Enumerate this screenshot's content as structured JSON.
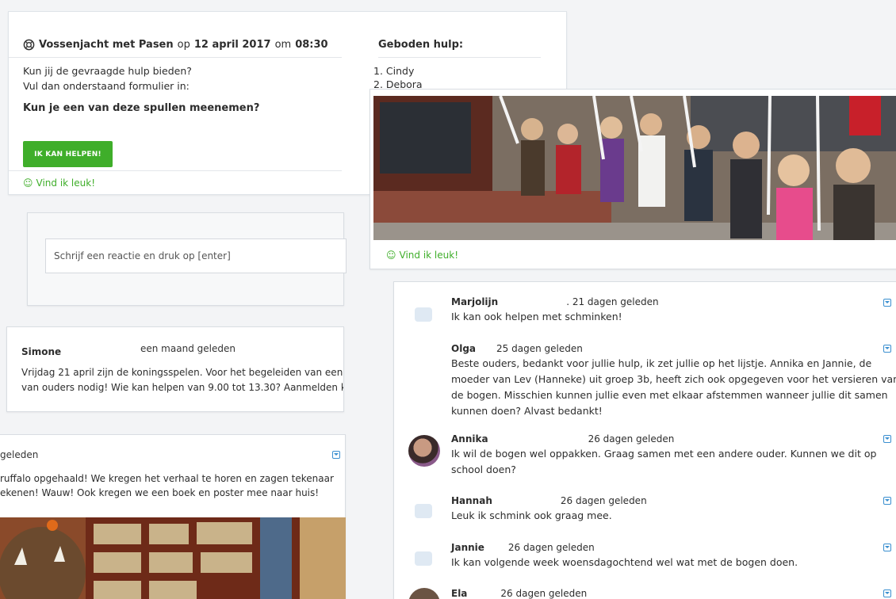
{
  "event": {
    "title": "Vossenjacht met Pasen",
    "date_prefix": "op",
    "date": "12 april 2017",
    "time_prefix": "om",
    "time": "08:30",
    "question_1": "Kun jij de gevraagde hulp bieden?",
    "question_2": "Vul dan onderstaand formulier in:",
    "items_question": "Kun je een van deze spullen meenemen?",
    "help_button": "IK KAN HELPEN!",
    "like_label": "Vind ik leuk!",
    "offered_title": "Geboden hulp:",
    "offered": [
      "1. Cindy",
      "2. Debora"
    ]
  },
  "reply": {
    "placeholder": "Schrijf een reactie en druk op [enter]"
  },
  "simone_post": {
    "author": "Simone",
    "time": "een maand geleden",
    "line_1": "Vrijdag 21 april zijn de koningsspelen. Voor het begeleiden van een",
    "line_2": "van ouders nodig! Wie kan helpen van 9.00 tot 13.30? Aanmelden k"
  },
  "gruffalo_post": {
    "time": "geleden",
    "line_1": "ruffalo opgehaald! We kregen het verhaal te horen en zagen tekenaar",
    "line_2": "ekenen! Wauw! Ook kregen we een boek en poster mee naar huis!"
  },
  "photo_post": {
    "like_label": "Vind ik leuk!"
  },
  "comments": [
    {
      "author": "Marjolijn",
      "time": ". 21 dagen geleden",
      "text": [
        "Ik kan ook helpen met schminken!"
      ]
    },
    {
      "author": "Olga",
      "time": "25 dagen geleden",
      "text": [
        "Beste ouders, bedankt voor jullie hulp, ik zet jullie op het lijstje. Annika en Jannie, de",
        "moeder van Lev (Hanneke) uit groep 3b, heeft zich ook opgegeven voor het versieren van",
        "de bogen. Misschien kunnen jullie even met elkaar afstemmen wanneer jullie dit samen",
        "kunnen doen? Alvast bedankt!"
      ]
    },
    {
      "author": "Annika",
      "time": "26 dagen geleden",
      "text": [
        "Ik wil de bogen wel oppakken. Graag samen met een andere ouder. Kunnen we dit op",
        "school doen?"
      ]
    },
    {
      "author": "Hannah",
      "time": "26 dagen geleden",
      "text": [
        "Leuk ik schmink ook graag mee."
      ]
    },
    {
      "author": "Jannie",
      "time": "26 dagen geleden",
      "text": [
        "Ik kan volgende week woensdagochtend wel wat met de bogen doen."
      ]
    },
    {
      "author": "Ela",
      "time": "26 dagen geleden",
      "text": []
    }
  ],
  "colors": {
    "accent_green": "#3fae2a",
    "expand_blue": "#3a8fd0"
  }
}
